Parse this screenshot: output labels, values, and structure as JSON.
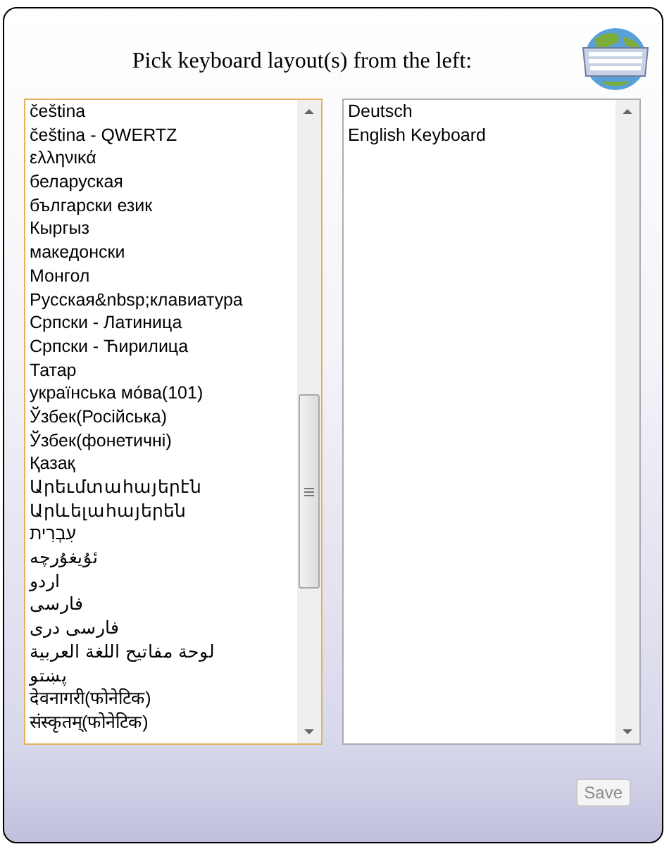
{
  "header": {
    "title": "Pick keyboard layout(s) from the left:"
  },
  "left_list": {
    "focused": true,
    "items": [
      "čeština",
      "čeština - QWERTZ",
      "ελληνικά",
      "беларуская",
      "български език",
      "Кыргыз",
      "македонски",
      "Монгол",
      "Русская&nbsp;клавиатура",
      "Српски - Латиница",
      "Српски - Ћирилица",
      "Татар",
      "українська мо́ва(101)",
      "Ўзбек(Російська)",
      "Ўзбек(фонетичні)",
      "Қазақ",
      "Արեւմտահայերէն",
      "Արևելահայերեն",
      "עִבְרִית",
      "ئۇيغۇرچە",
      "اردو",
      "فارسی",
      "فارسی دری",
      "لوحة مفاتيح اللغة العربية",
      "پښتو",
      "देवनागरी(फोनेटिक)",
      "संस्कृतम्(फोनेटिक)"
    ]
  },
  "right_list": {
    "focused": false,
    "items": [
      "Deutsch",
      "English Keyboard"
    ]
  },
  "save_button": {
    "label": "Save",
    "disabled": true
  }
}
